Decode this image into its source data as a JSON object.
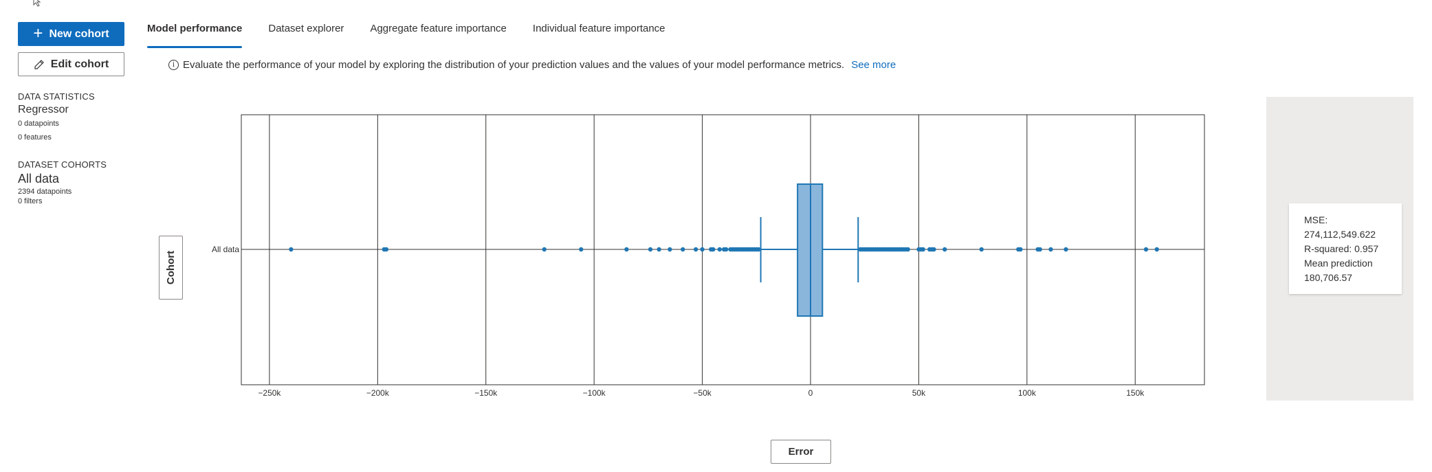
{
  "sidebar": {
    "new_cohort_label": "New cohort",
    "edit_cohort_label": "Edit cohort",
    "data_statistics_heading": "DATA STATISTICS",
    "model_type": "Regressor",
    "datapoints": "0 datapoints",
    "features": "0 features",
    "dataset_cohorts_heading": "DATASET COHORTS",
    "cohort_name": "All data",
    "cohort_datapoints": "2394 datapoints",
    "cohort_filters": "0 filters"
  },
  "tabs": [
    {
      "label": "Model performance",
      "active": true
    },
    {
      "label": "Dataset explorer",
      "active": false
    },
    {
      "label": "Aggregate feature importance",
      "active": false
    },
    {
      "label": "Individual feature importance",
      "active": false
    }
  ],
  "info": {
    "text": "Evaluate the performance of your model by exploring the distribution of your prediction values and the values of your model performance metrics.",
    "link": "See more"
  },
  "cohort_axis_button": "Cohort",
  "error_axis_button": "Error",
  "metrics": {
    "mse_label": "MSE:",
    "mse_value": "274,112,549.622",
    "r_squared": "R-squared: 0.957",
    "mean_prediction_label": "Mean prediction",
    "mean_prediction_value": "180,706.57"
  },
  "colors": {
    "accent": "#0f6cbd",
    "box_fill": "#8ab6dc",
    "box_stroke": "#1f77b4",
    "point": "#1f77b4"
  },
  "chart_data": {
    "type": "box",
    "orientation": "horizontal",
    "categories": [
      "All data"
    ],
    "xlim": [
      -263000,
      182000
    ],
    "xticks": [
      -250000,
      -200000,
      -150000,
      -100000,
      -50000,
      0,
      50000,
      100000,
      150000
    ],
    "xtick_labels": [
      "−250k",
      "−200k",
      "−150k",
      "−100k",
      "−50k",
      "0",
      "50k",
      "100k",
      "150k"
    ],
    "box": {
      "q1": -6000,
      "median": 0,
      "q3": 5500,
      "lower_fence": -23000,
      "upper_fence": 22000
    },
    "outliers": [
      -240000,
      -197000,
      -196000,
      -123000,
      -106000,
      -85000,
      -74000,
      -70000,
      -65000,
      -59000,
      -53000,
      -50000,
      -46000,
      -45000,
      -42000,
      -40000,
      -39000,
      -37000,
      -36000,
      -35000,
      -34000,
      -33000,
      -32000,
      -31000,
      -30000,
      -29000,
      -28000,
      -27000,
      -26000,
      -25000,
      -24000,
      23000,
      24000,
      25000,
      26000,
      27000,
      28000,
      29000,
      30000,
      31000,
      32000,
      33000,
      34000,
      35000,
      36000,
      37000,
      38000,
      39000,
      40000,
      41000,
      42000,
      43000,
      44000,
      45000,
      50000,
      51000,
      52000,
      55000,
      56000,
      57000,
      62000,
      79000,
      96000,
      97000,
      105000,
      106000,
      111000,
      118000,
      155000,
      160000
    ],
    "grid": true
  }
}
